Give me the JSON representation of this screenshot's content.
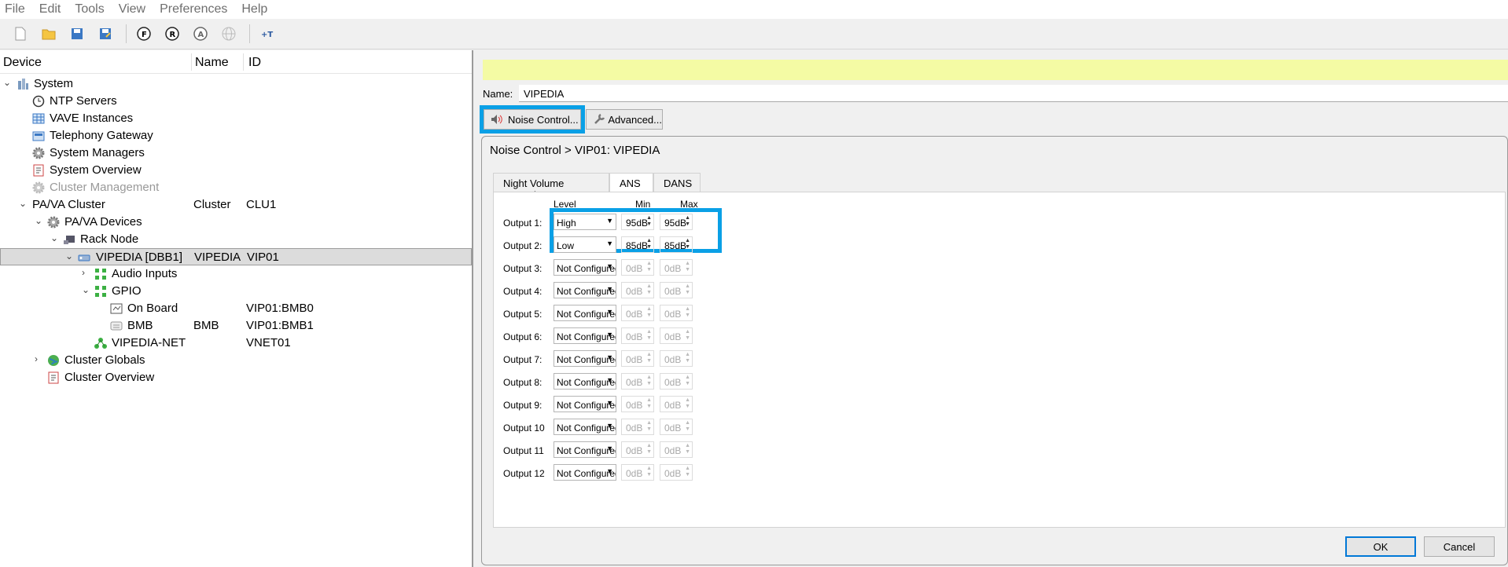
{
  "menu": [
    "File",
    "Edit",
    "Tools",
    "View",
    "Preferences",
    "Help"
  ],
  "toolbar": {
    "icons": [
      "new-file-icon",
      "open-folder-icon",
      "save-icon",
      "save-all-icon",
      "f-icon",
      "r-icon",
      "a-icon",
      "globe-icon",
      "text-tool-icon"
    ]
  },
  "tree": {
    "headers": {
      "device": "Device",
      "name": "Name",
      "id": "ID"
    },
    "rows": [
      {
        "label": "System",
        "name": "",
        "id": "",
        "icon": "system-icon"
      },
      {
        "label": "NTP Servers",
        "name": "",
        "id": "",
        "icon": "clock-icon"
      },
      {
        "label": "VAVE Instances",
        "name": "",
        "id": "",
        "icon": "grid-icon"
      },
      {
        "label": "Telephony Gateway",
        "name": "",
        "id": "",
        "icon": "phone-icon"
      },
      {
        "label": "System Managers",
        "name": "",
        "id": "",
        "icon": "gear-icon"
      },
      {
        "label": "System Overview",
        "name": "",
        "id": "",
        "icon": "document-icon"
      },
      {
        "label": "Cluster Management",
        "name": "",
        "id": "",
        "icon": "gear-icon"
      },
      {
        "label": "PA/VA Cluster",
        "name": "Cluster",
        "id": "CLU1",
        "icon": ""
      },
      {
        "label": "PA/VA Devices",
        "name": "",
        "id": "",
        "icon": "gear-icon"
      },
      {
        "label": "Rack Node",
        "name": "",
        "id": "",
        "icon": "rack-icon"
      },
      {
        "label": "VIPEDIA [DBB1]",
        "name": "VIPEDIA",
        "id": "VIP01",
        "icon": "device-icon"
      },
      {
        "label": "Audio Inputs",
        "name": "",
        "id": "",
        "icon": "audio-inputs-icon"
      },
      {
        "label": "GPIO",
        "name": "",
        "id": "",
        "icon": "gpio-icon"
      },
      {
        "label": "On Board",
        "name": "",
        "id": "VIP01:BMB0",
        "icon": "board-icon"
      },
      {
        "label": "BMB",
        "name": "BMB",
        "id": "VIP01:BMB1",
        "icon": "board-icon"
      },
      {
        "label": "VIPEDIA-NET",
        "name": "",
        "id": "VNET01",
        "icon": "network-icon"
      },
      {
        "label": "Cluster Globals",
        "name": "",
        "id": "",
        "icon": "globe-icon"
      },
      {
        "label": "Cluster Overview",
        "name": "",
        "id": "",
        "icon": "document-icon"
      }
    ]
  },
  "props": {
    "name_label": "Name:",
    "name_value": "VIPEDIA",
    "noise_btn": "Noise Control...",
    "advanced_btn": "Advanced..."
  },
  "dialog": {
    "title": "Noise Control > VIP01: VIPEDIA",
    "tabs": [
      "Night Volume Control",
      "ANS",
      "DANS"
    ],
    "active_tab": "ANS",
    "col_level": "Level",
    "col_min": "Min",
    "col_max": "Max",
    "outputs": [
      {
        "label": "Output 1:",
        "level": "High",
        "min": "95dB",
        "max": "95dB",
        "enabled": true
      },
      {
        "label": "Output 2:",
        "level": "Low",
        "min": "85dB",
        "max": "85dB",
        "enabled": true
      },
      {
        "label": "Output 3:",
        "level": "Not Configured",
        "min": "0dB",
        "max": "0dB",
        "enabled": false
      },
      {
        "label": "Output 4:",
        "level": "Not Configured",
        "min": "0dB",
        "max": "0dB",
        "enabled": false
      },
      {
        "label": "Output 5:",
        "level": "Not Configured",
        "min": "0dB",
        "max": "0dB",
        "enabled": false
      },
      {
        "label": "Output 6:",
        "level": "Not Configured",
        "min": "0dB",
        "max": "0dB",
        "enabled": false
      },
      {
        "label": "Output 7:",
        "level": "Not Configured",
        "min": "0dB",
        "max": "0dB",
        "enabled": false
      },
      {
        "label": "Output 8:",
        "level": "Not Configured",
        "min": "0dB",
        "max": "0dB",
        "enabled": false
      },
      {
        "label": "Output 9:",
        "level": "Not Configured",
        "min": "0dB",
        "max": "0dB",
        "enabled": false
      },
      {
        "label": "Output 10",
        "level": "Not Configured",
        "min": "0dB",
        "max": "0dB",
        "enabled": false
      },
      {
        "label": "Output 11",
        "level": "Not Configured",
        "min": "0dB",
        "max": "0dB",
        "enabled": false
      },
      {
        "label": "Output 12",
        "level": "Not Configured",
        "min": "0dB",
        "max": "0dB",
        "enabled": false
      }
    ],
    "ok": "OK",
    "cancel": "Cancel"
  },
  "colors": {
    "highlight": "#0aa0e6",
    "info_bar": "#f4fba4"
  }
}
